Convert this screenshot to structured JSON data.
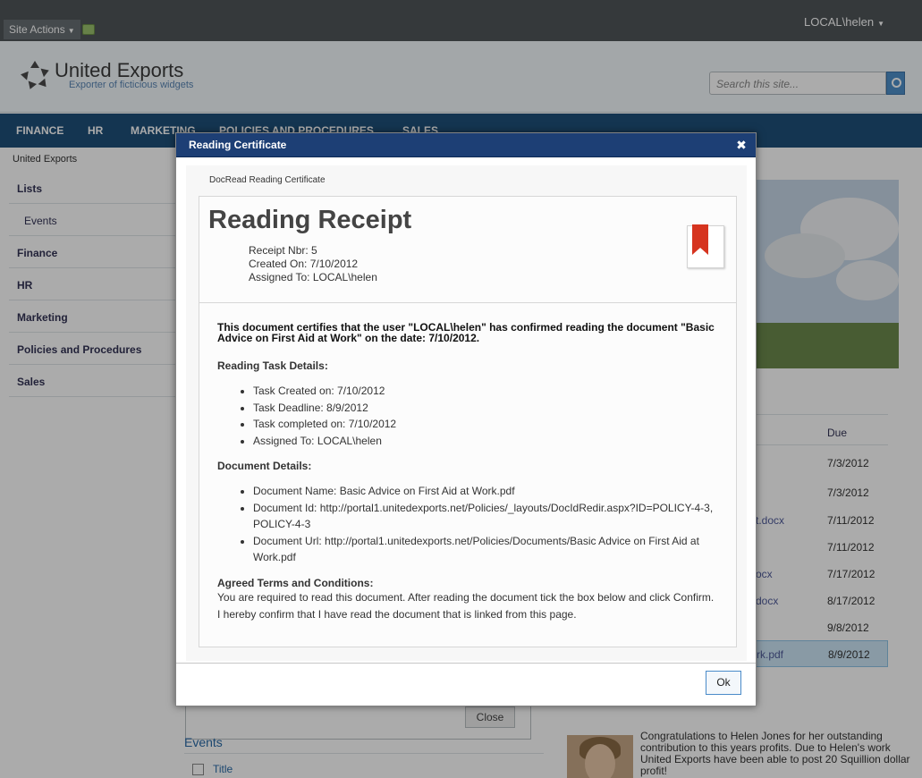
{
  "ribbon": {
    "site_actions": "Site Actions",
    "user": "LOCAL\\helen"
  },
  "header": {
    "title": "United Exports",
    "subtitle": "Exporter of ficticious widgets",
    "search_placeholder": "Search this site..."
  },
  "topnav": [
    "FINANCE",
    "HR",
    "MARKETING",
    "POLICIES AND PROCEDURES",
    "SALES"
  ],
  "breadcrumb": "United Exports",
  "leftnav": [
    "Lists",
    "Events",
    "Finance",
    "HR",
    "Marketing",
    "Policies and Procedures",
    "Sales"
  ],
  "tasks": {
    "due_header": "Due",
    "rows": [
      {
        "name": "",
        "due": "7/3/2012"
      },
      {
        "name": "",
        "due": "7/3/2012"
      },
      {
        "name": "t.docx",
        "due": "7/11/2012"
      },
      {
        "name": "",
        "due": "7/11/2012"
      },
      {
        "name": "ocx",
        "due": "7/17/2012"
      },
      {
        "name": "docx",
        "due": "8/17/2012"
      },
      {
        "name": "",
        "due": "9/8/2012"
      },
      {
        "name": "rk.pdf",
        "due": "8/9/2012"
      }
    ]
  },
  "background": {
    "close_label": "Close",
    "events_title": "Events",
    "events_column": "Title",
    "congrats": "Congratulations to Helen Jones for her outstanding contribution to this years profits. Due to Helen's work United Exports have been able to post 20 Squillion dollar profit!"
  },
  "dialog": {
    "title": "Reading Certificate",
    "close_symbol": "✖",
    "caption": "DocRead Reading Certificate",
    "receipt_title": "Reading Receipt",
    "receipt_nbr": "Receipt Nbr: 5",
    "created_on": "Created On: 7/10/2012",
    "assigned_to": "Assigned To: LOCAL\\helen",
    "certify_text": "This document certifies that the user \"LOCAL\\helen\" has confirmed reading the document \"Basic Advice on First Aid at Work\" on the date: 7/10/2012.",
    "task_heading": "Reading Task Details:",
    "task_details": [
      "Task Created on: 7/10/2012",
      "Task Deadline: 8/9/2012",
      "Task completed on: 7/10/2012",
      "Assigned To: LOCAL\\helen"
    ],
    "doc_heading": "Document Details:",
    "doc_details": [
      "Document Name: Basic Advice on First Aid at Work.pdf",
      "Document Id: http://portal1.unitedexports.net/Policies/_layouts/DocIdRedir.aspx?ID=POLICY-4-3, POLICY-4-3",
      "Document Url: http://portal1.unitedexports.net/Policies/Documents/Basic Advice on First Aid at Work.pdf"
    ],
    "terms_heading": "Agreed Terms and Conditions:",
    "terms_text": "You are required to read this document. After reading the document tick the box below and click Confirm. I hereby confirm that I have read the document that is linked from this page.",
    "ok_label": "Ok"
  }
}
